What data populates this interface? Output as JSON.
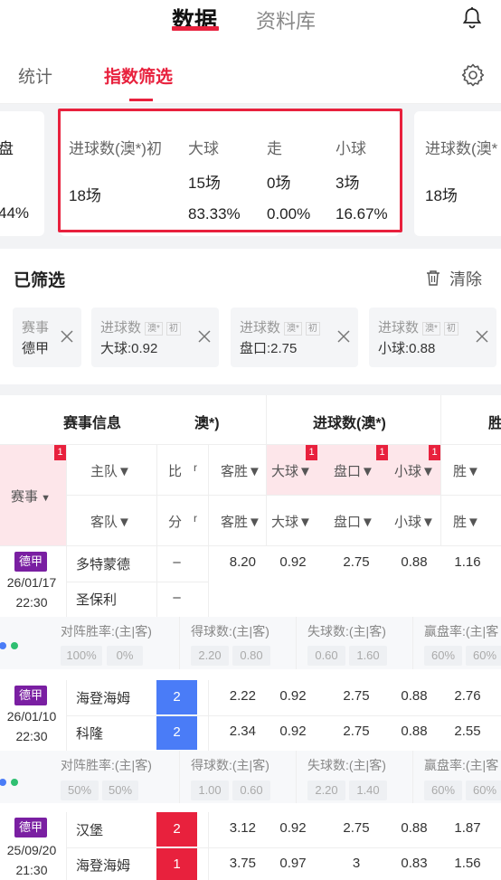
{
  "header": {
    "tab_data": "数据",
    "tab_library": "资料库"
  },
  "subtabs": {
    "stats": "统计",
    "index_filter": "指数筛选"
  },
  "stat_cards": {
    "left_partial": {
      "h1": "盘",
      "v1": "",
      "v2": "44%"
    },
    "main": {
      "col1_title": "进球数(澳*)初",
      "col1_value": "18场",
      "col2_title": "大球",
      "col2_count": "15场",
      "col2_pct": "83.33%",
      "col3_title": "走",
      "col3_count": "0场",
      "col3_pct": "0.00%",
      "col4_title": "小球",
      "col4_count": "3场",
      "col4_pct": "16.67%"
    },
    "right_partial": {
      "title": "进球数(澳*",
      "value": "18场"
    }
  },
  "filters": {
    "title": "已筛选",
    "clear_label": "清除",
    "chips": [
      {
        "title": "赛事",
        "value": "德甲",
        "tag1": "",
        "tag2": ""
      },
      {
        "title": "进球数",
        "tag1": "澳*",
        "tag2": "初",
        "value": "大球:0.92"
      },
      {
        "title": "进球数",
        "tag1": "澳*",
        "tag2": "初",
        "value": "盘口:2.75"
      },
      {
        "title": "进球数",
        "tag1": "澳*",
        "tag2": "初",
        "value": "小球:0.88"
      }
    ]
  },
  "table": {
    "group_headers": {
      "match_info": "赛事信息",
      "partial": "澳*)",
      "goals": "进球数(澳*)",
      "win_partial": "胜"
    },
    "headers_row1": {
      "league": "赛事",
      "home": "主队▼",
      "score_top": "比",
      "score_top2": "r",
      "away_win": "客胜▼",
      "big": "大球▼",
      "line": "盘口▼",
      "small": "小球▼",
      "win": "胜▼"
    },
    "headers_row2": {
      "away": "客队▼",
      "score_bot": "分",
      "score_bot2": "r",
      "away_win": "客胜▼",
      "big": "大球▼",
      "line": "盘口▼",
      "small": "小球▼",
      "win": "胜▼"
    },
    "flag_count": "1",
    "stats_labels": {
      "h2h": "对阵胜率:(主|客)",
      "gf": "得球数:(主|客)",
      "ga": "失球数:(主|客)",
      "cover": "赢盘率:(主|客"
    },
    "matches": [
      {
        "league": "德甲",
        "date": "26/01/17",
        "time": "22:30",
        "home": "多特蒙德",
        "away": "圣保利",
        "home_score": "–",
        "away_score": "–",
        "home_odds": "8.20",
        "home_big": "0.92",
        "home_line": "2.75",
        "home_small": "0.88",
        "home_win": "1.16",
        "away_odds": "",
        "away_big": "",
        "away_line": "",
        "away_small": "",
        "away_win": "",
        "stats": {
          "h2h": [
            "100%",
            "0%"
          ],
          "gf": [
            "2.20",
            "0.80"
          ],
          "ga": [
            "0.60",
            "1.60"
          ],
          "cover": [
            "60%",
            "60%"
          ]
        }
      },
      {
        "league": "德甲",
        "date": "26/01/10",
        "time": "22:30",
        "home": "海登海姆",
        "away": "科隆",
        "home_score": "2",
        "away_score": "2",
        "home_odds": "2.22",
        "home_big": "0.92",
        "home_line": "2.75",
        "home_small": "0.88",
        "home_win": "2.76",
        "away_odds": "2.34",
        "away_big": "0.92",
        "away_line": "2.75",
        "away_small": "0.88",
        "away_win": "2.55",
        "stats": {
          "h2h": [
            "50%",
            "50%"
          ],
          "gf": [
            "1.00",
            "0.60"
          ],
          "ga": [
            "2.20",
            "1.40"
          ],
          "cover": [
            "60%",
            "60%"
          ]
        }
      },
      {
        "league": "德甲",
        "date": "25/09/20",
        "time": "21:30",
        "home": "汉堡",
        "away": "海登海姆",
        "home_score": "2",
        "away_score": "1",
        "home_odds": "3.12",
        "home_big": "0.92",
        "home_line": "2.75",
        "home_small": "0.88",
        "home_win": "1.87",
        "away_odds": "3.75",
        "away_big": "0.97",
        "away_line": "3",
        "away_small": "0.83",
        "away_win": "1.56"
      }
    ]
  },
  "colors": {
    "accent": "#e8213d",
    "league_badge": "#7a1fa2",
    "score_blue": "#4a7cf7",
    "highlight_pink": "#fde6ea",
    "highlight_box": "#e8213d"
  },
  "icons": [
    "bell-icon",
    "gear-icon",
    "trash-icon",
    "close-icon",
    "chevron-down-icon"
  ]
}
